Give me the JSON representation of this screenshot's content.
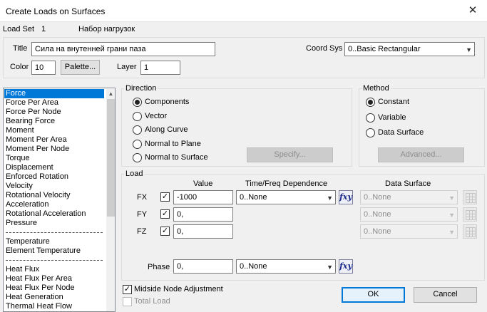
{
  "window": {
    "title": "Create Loads on Surfaces",
    "close_glyph": "✕"
  },
  "load_set": {
    "label": "Load Set",
    "number": "1",
    "name": "Набор нагрузок"
  },
  "header": {
    "title_label": "Title",
    "title_value": "Сила на внутенней грани паза",
    "coord_sys_label": "Coord Sys",
    "coord_sys_value": "0..Basic Rectangular",
    "color_label": "Color",
    "color_value": "10",
    "palette_button": "Palette...",
    "layer_label": "Layer",
    "layer_value": "1"
  },
  "load_types": {
    "items": [
      "Force",
      "Force Per Area",
      "Force Per Node",
      "Bearing Force",
      "Moment",
      "Moment Per Area",
      "Moment Per Node",
      "Torque",
      "Displacement",
      "Enforced Rotation",
      "Velocity",
      "Rotational Velocity",
      "Acceleration",
      "Rotational Acceleration",
      "Pressure",
      "---",
      "Temperature",
      "Element Temperature",
      "---",
      "Heat Flux",
      "Heat Flux Per Area",
      "Heat Flux Per Node",
      "Heat Generation",
      "Thermal Heat Flow"
    ],
    "selected": "Force"
  },
  "direction": {
    "label": "Direction",
    "options": [
      "Components",
      "Vector",
      "Along Curve",
      "Normal to Plane",
      "Normal to Surface"
    ],
    "selected": "Components",
    "specify_button": "Specify..."
  },
  "method": {
    "label": "Method",
    "options": [
      "Constant",
      "Variable",
      "Data Surface"
    ],
    "selected": "Constant",
    "advanced_button": "Advanced..."
  },
  "load": {
    "label": "Load",
    "col_value": "Value",
    "col_dependence": "Time/Freq Dependence",
    "col_data_surface": "Data Surface",
    "rows": [
      {
        "axis": "FX",
        "checked": true,
        "value": "-1000",
        "dependence": "0..None",
        "data_surface": "0..None"
      },
      {
        "axis": "FY",
        "checked": true,
        "value": "0,",
        "data_surface": "0..None"
      },
      {
        "axis": "FZ",
        "checked": true,
        "value": "0,",
        "data_surface": "0..None"
      }
    ],
    "phase_label": "Phase",
    "phase_value": "0,",
    "phase_dependence": "0..None",
    "fxy_label": "fxy"
  },
  "options": {
    "midside_label": "Midside Node Adjustment",
    "midside_checked": true,
    "total_label": "Total Load",
    "total_checked": false
  },
  "buttons": {
    "ok": "OK",
    "cancel": "Cancel"
  }
}
